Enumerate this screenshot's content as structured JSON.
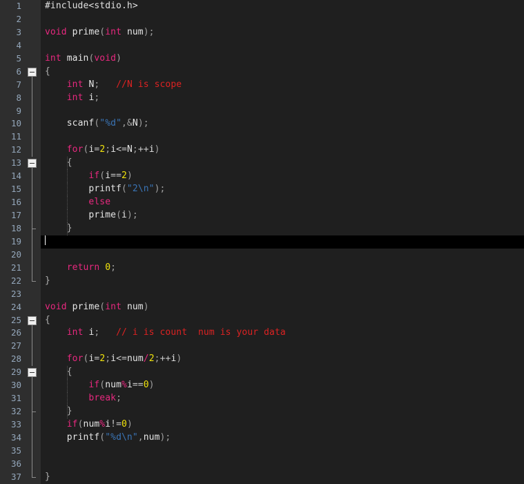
{
  "editor": {
    "name": "code-editor",
    "language": "C",
    "colors": {
      "gutter_bg": "#2e2e2e",
      "code_bg": "#1f1f1f",
      "current_line_bg": "#000000",
      "line_number": "#94a7bb",
      "keyword": "#e8287f",
      "number": "#f2e40c",
      "string": "#3a74b5",
      "comment": "#dd2222",
      "plain": "#d4d4d4",
      "punctuation": "#a0a0a0",
      "fold_box": "#f0f0f0"
    },
    "current_line": 19,
    "total_lines": 37
  },
  "lines": [
    {
      "n": "1",
      "fold": "none",
      "tokens": [
        {
          "t": "#include<stdio.h>",
          "c": "pre"
        }
      ]
    },
    {
      "n": "2",
      "fold": "none",
      "tokens": []
    },
    {
      "n": "3",
      "fold": "none",
      "tokens": [
        {
          "t": "void",
          "c": "kw"
        },
        {
          "t": " ",
          "c": "ws"
        },
        {
          "t": "prime",
          "c": "fn"
        },
        {
          "t": "(",
          "c": "pun"
        },
        {
          "t": "int",
          "c": "kw"
        },
        {
          "t": " ",
          "c": "ws"
        },
        {
          "t": "num",
          "c": "fn"
        },
        {
          "t": ");",
          "c": "pun"
        }
      ]
    },
    {
      "n": "4",
      "fold": "none",
      "tokens": []
    },
    {
      "n": "5",
      "fold": "none",
      "tokens": [
        {
          "t": "int",
          "c": "kw"
        },
        {
          "t": " ",
          "c": "ws"
        },
        {
          "t": "main",
          "c": "fn"
        },
        {
          "t": "(",
          "c": "pun"
        },
        {
          "t": "void",
          "c": "kw"
        },
        {
          "t": ")",
          "c": "pun"
        }
      ]
    },
    {
      "n": "6",
      "fold": "start",
      "tokens": [
        {
          "t": "{",
          "c": "brace"
        }
      ]
    },
    {
      "n": "7",
      "fold": "body",
      "tokens": [
        {
          "t": "    ",
          "c": "ws"
        },
        {
          "t": "int",
          "c": "kw"
        },
        {
          "t": " ",
          "c": "ws"
        },
        {
          "t": "N",
          "c": "fn"
        },
        {
          "t": ";",
          "c": "pun"
        },
        {
          "t": "   ",
          "c": "ws"
        },
        {
          "t": "//N is scope",
          "c": "cmt"
        }
      ]
    },
    {
      "n": "8",
      "fold": "body",
      "tokens": [
        {
          "t": "    ",
          "c": "ws"
        },
        {
          "t": "int",
          "c": "kw"
        },
        {
          "t": " ",
          "c": "ws"
        },
        {
          "t": "i",
          "c": "fn"
        },
        {
          "t": ";",
          "c": "pun"
        }
      ]
    },
    {
      "n": "9",
      "fold": "body",
      "tokens": []
    },
    {
      "n": "10",
      "fold": "body",
      "tokens": [
        {
          "t": "    ",
          "c": "ws"
        },
        {
          "t": "scanf",
          "c": "fn"
        },
        {
          "t": "(",
          "c": "pun"
        },
        {
          "t": "\"%d\"",
          "c": "str"
        },
        {
          "t": ",&",
          "c": "pun"
        },
        {
          "t": "N",
          "c": "fn"
        },
        {
          "t": ");",
          "c": "pun"
        }
      ]
    },
    {
      "n": "11",
      "fold": "body",
      "tokens": []
    },
    {
      "n": "12",
      "fold": "body",
      "tokens": [
        {
          "t": "    ",
          "c": "ws"
        },
        {
          "t": "for",
          "c": "kw"
        },
        {
          "t": "(",
          "c": "pun"
        },
        {
          "t": "i",
          "c": "fn"
        },
        {
          "t": "=",
          "c": "pl"
        },
        {
          "t": "2",
          "c": "num"
        },
        {
          "t": ";",
          "c": "pun"
        },
        {
          "t": "i",
          "c": "fn"
        },
        {
          "t": "<=",
          "c": "pl"
        },
        {
          "t": "N",
          "c": "fn"
        },
        {
          "t": ";",
          "c": "pun"
        },
        {
          "t": "++",
          "c": "pl"
        },
        {
          "t": "i",
          "c": "fn"
        },
        {
          "t": ")",
          "c": "pun"
        }
      ]
    },
    {
      "n": "13",
      "fold": "start-nested",
      "tokens": [
        {
          "t": "    ",
          "c": "ws"
        },
        {
          "t": "{",
          "c": "brace"
        }
      ]
    },
    {
      "n": "14",
      "fold": "body-nested",
      "tokens": [
        {
          "t": "        ",
          "c": "ws"
        },
        {
          "t": "if",
          "c": "kw"
        },
        {
          "t": "(",
          "c": "pun"
        },
        {
          "t": "i",
          "c": "fn"
        },
        {
          "t": "==",
          "c": "pl"
        },
        {
          "t": "2",
          "c": "num"
        },
        {
          "t": ")",
          "c": "pun"
        }
      ]
    },
    {
      "n": "15",
      "fold": "body-nested",
      "tokens": [
        {
          "t": "        ",
          "c": "ws"
        },
        {
          "t": "printf",
          "c": "fn"
        },
        {
          "t": "(",
          "c": "pun"
        },
        {
          "t": "\"2\\n\"",
          "c": "str"
        },
        {
          "t": ");",
          "c": "pun"
        }
      ]
    },
    {
      "n": "16",
      "fold": "body-nested",
      "tokens": [
        {
          "t": "        ",
          "c": "ws"
        },
        {
          "t": "else",
          "c": "kw"
        }
      ]
    },
    {
      "n": "17",
      "fold": "body-nested",
      "tokens": [
        {
          "t": "        ",
          "c": "ws"
        },
        {
          "t": "prime",
          "c": "fn"
        },
        {
          "t": "(",
          "c": "pun"
        },
        {
          "t": "i",
          "c": "fn"
        },
        {
          "t": ");",
          "c": "pun"
        }
      ]
    },
    {
      "n": "18",
      "fold": "end-nested",
      "tokens": [
        {
          "t": "    ",
          "c": "ws"
        },
        {
          "t": "}",
          "c": "brace"
        }
      ]
    },
    {
      "n": "19",
      "fold": "body",
      "tokens": [],
      "current": true
    },
    {
      "n": "20",
      "fold": "body",
      "tokens": []
    },
    {
      "n": "21",
      "fold": "body",
      "tokens": [
        {
          "t": "    ",
          "c": "ws"
        },
        {
          "t": "return",
          "c": "kw"
        },
        {
          "t": " ",
          "c": "ws"
        },
        {
          "t": "0",
          "c": "num"
        },
        {
          "t": ";",
          "c": "pun"
        }
      ]
    },
    {
      "n": "22",
      "fold": "end",
      "tokens": [
        {
          "t": "}",
          "c": "brace"
        }
      ]
    },
    {
      "n": "23",
      "fold": "none",
      "tokens": []
    },
    {
      "n": "24",
      "fold": "none",
      "tokens": [
        {
          "t": "void",
          "c": "kw"
        },
        {
          "t": " ",
          "c": "ws"
        },
        {
          "t": "prime",
          "c": "fn"
        },
        {
          "t": "(",
          "c": "pun"
        },
        {
          "t": "int",
          "c": "kw"
        },
        {
          "t": " ",
          "c": "ws"
        },
        {
          "t": "num",
          "c": "fn"
        },
        {
          "t": ")",
          "c": "pun"
        }
      ]
    },
    {
      "n": "25",
      "fold": "start",
      "tokens": [
        {
          "t": "{",
          "c": "brace"
        }
      ]
    },
    {
      "n": "26",
      "fold": "body",
      "tokens": [
        {
          "t": "    ",
          "c": "ws"
        },
        {
          "t": "int",
          "c": "kw"
        },
        {
          "t": " ",
          "c": "ws"
        },
        {
          "t": "i",
          "c": "fn"
        },
        {
          "t": ";",
          "c": "pun"
        },
        {
          "t": "   ",
          "c": "ws"
        },
        {
          "t": "// i is count  num is your data",
          "c": "cmt"
        }
      ]
    },
    {
      "n": "27",
      "fold": "body",
      "tokens": []
    },
    {
      "n": "28",
      "fold": "body",
      "tokens": [
        {
          "t": "    ",
          "c": "ws"
        },
        {
          "t": "for",
          "c": "kw"
        },
        {
          "t": "(",
          "c": "pun"
        },
        {
          "t": "i",
          "c": "fn"
        },
        {
          "t": "=",
          "c": "pl"
        },
        {
          "t": "2",
          "c": "num"
        },
        {
          "t": ";",
          "c": "pun"
        },
        {
          "t": "i",
          "c": "fn"
        },
        {
          "t": "<=",
          "c": "pl"
        },
        {
          "t": "num",
          "c": "fn"
        },
        {
          "t": "/",
          "c": "op"
        },
        {
          "t": "2",
          "c": "num"
        },
        {
          "t": ";",
          "c": "pun"
        },
        {
          "t": "++",
          "c": "pl"
        },
        {
          "t": "i",
          "c": "fn"
        },
        {
          "t": ")",
          "c": "pun"
        }
      ]
    },
    {
      "n": "29",
      "fold": "start-nested",
      "tokens": [
        {
          "t": "    ",
          "c": "ws"
        },
        {
          "t": "{",
          "c": "brace"
        }
      ]
    },
    {
      "n": "30",
      "fold": "body-nested",
      "tokens": [
        {
          "t": "        ",
          "c": "ws"
        },
        {
          "t": "if",
          "c": "kw"
        },
        {
          "t": "(",
          "c": "pun"
        },
        {
          "t": "num",
          "c": "fn"
        },
        {
          "t": "%",
          "c": "op"
        },
        {
          "t": "i",
          "c": "fn"
        },
        {
          "t": "==",
          "c": "pl"
        },
        {
          "t": "0",
          "c": "num"
        },
        {
          "t": ")",
          "c": "pun"
        }
      ]
    },
    {
      "n": "31",
      "fold": "body-nested",
      "tokens": [
        {
          "t": "        ",
          "c": "ws"
        },
        {
          "t": "break",
          "c": "kw"
        },
        {
          "t": ";",
          "c": "pun"
        }
      ]
    },
    {
      "n": "32",
      "fold": "end-nested",
      "tokens": [
        {
          "t": "    ",
          "c": "ws"
        },
        {
          "t": "}",
          "c": "brace"
        }
      ]
    },
    {
      "n": "33",
      "fold": "body",
      "tokens": [
        {
          "t": "    ",
          "c": "ws"
        },
        {
          "t": "if",
          "c": "kw"
        },
        {
          "t": "(",
          "c": "pun"
        },
        {
          "t": "num",
          "c": "fn"
        },
        {
          "t": "%",
          "c": "op"
        },
        {
          "t": "i",
          "c": "fn"
        },
        {
          "t": "!=",
          "c": "pl"
        },
        {
          "t": "0",
          "c": "num"
        },
        {
          "t": ")",
          "c": "pun"
        }
      ]
    },
    {
      "n": "34",
      "fold": "body",
      "tokens": [
        {
          "t": "    ",
          "c": "ws"
        },
        {
          "t": "printf",
          "c": "fn"
        },
        {
          "t": "(",
          "c": "pun"
        },
        {
          "t": "\"%d\\n\"",
          "c": "str"
        },
        {
          "t": ",",
          "c": "pun"
        },
        {
          "t": "num",
          "c": "fn"
        },
        {
          "t": ");",
          "c": "pun"
        }
      ]
    },
    {
      "n": "35",
      "fold": "body",
      "tokens": []
    },
    {
      "n": "36",
      "fold": "body",
      "tokens": []
    },
    {
      "n": "37",
      "fold": "end",
      "tokens": [
        {
          "t": "}",
          "c": "brace"
        }
      ]
    }
  ]
}
